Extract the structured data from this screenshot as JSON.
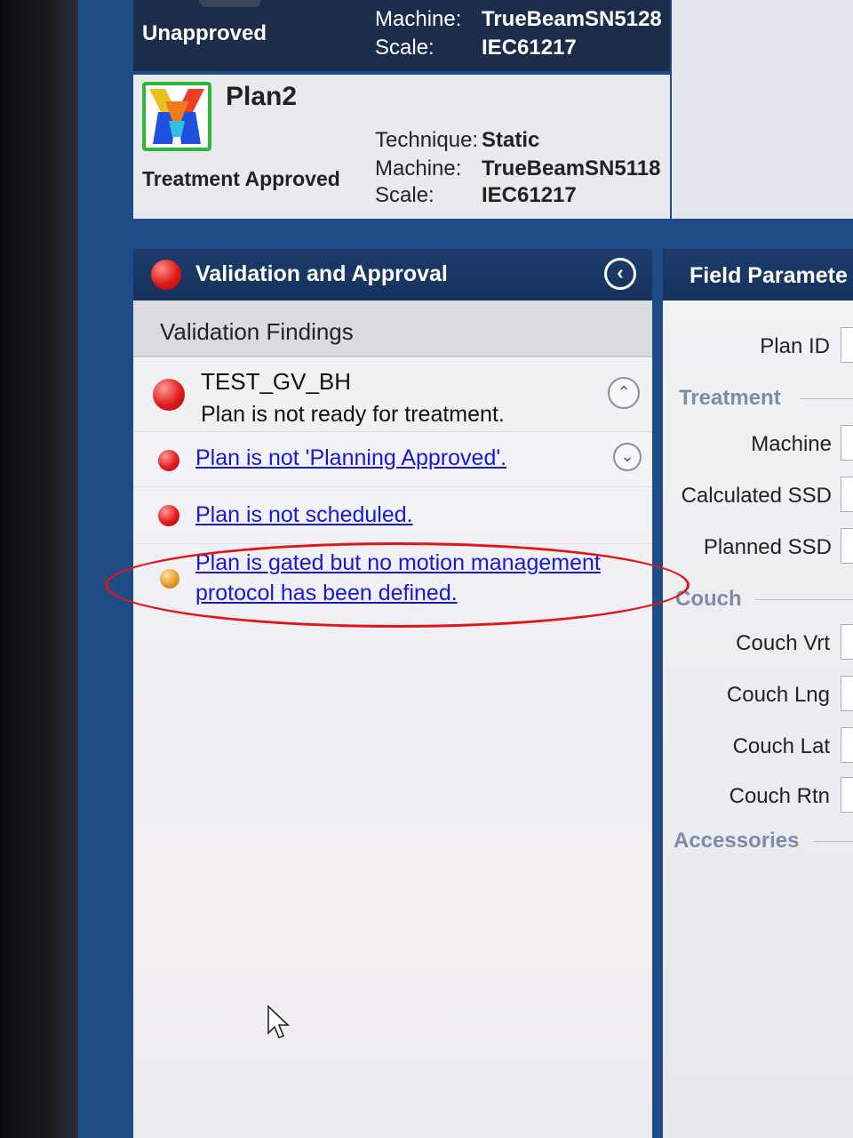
{
  "plans": [
    {
      "status": "Unapproved",
      "machine_label": "Machine:",
      "machine": "TrueBeamSN5128",
      "scale_label": "Scale:",
      "scale": "IEC61217"
    },
    {
      "name": "Plan2",
      "status": "Treatment Approved",
      "technique_label": "Technique:",
      "technique": "Static",
      "machine_label": "Machine:",
      "machine": "TrueBeamSN5118",
      "scale_label": "Scale:",
      "scale": "IEC61217"
    }
  ],
  "validation_panel": {
    "title": "Validation and Approval",
    "collapse_icon": "chevron-left-icon",
    "findings_header": "Validation Findings",
    "main_finding": {
      "title": "TEST_GV_BH",
      "subtitle": "Plan is not ready for treatment.",
      "severity": "error"
    },
    "findings": [
      {
        "text": "Plan is not 'Planning Approved'.",
        "severity": "error"
      },
      {
        "text": "Plan is not scheduled.",
        "severity": "error"
      },
      {
        "text_line1": "Plan is gated but no motion management",
        "text_line2": "protocol has been defined.",
        "severity": "warning"
      }
    ]
  },
  "field_panel": {
    "title": "Field Paramete",
    "plan_id_label": "Plan ID",
    "treatment_section": "Treatment",
    "machine_label": "Machine",
    "calculated_ssd_label": "Calculated SSD",
    "planned_ssd_label": "Planned SSD",
    "couch_section": "Couch",
    "couch_vrt_label": "Couch Vrt",
    "couch_lng_label": "Couch Lng",
    "couch_lat_label": "Couch Lat",
    "couch_rtn_label": "Couch Rtn",
    "accessories_section": "Accessories"
  },
  "colors": {
    "header_blue": "#1d3c6c",
    "error_red": "#e21b1b",
    "warning_orange": "#e59a2c",
    "link_blue": "#1818d8",
    "annotation_red": "#e01515"
  }
}
